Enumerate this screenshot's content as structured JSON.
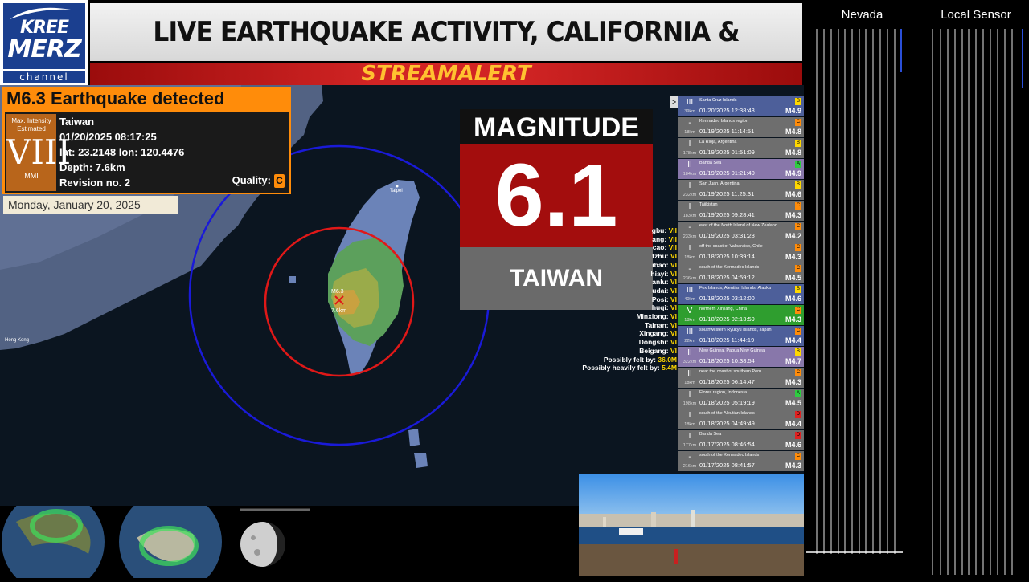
{
  "logo": {
    "line1": "KREE",
    "line2": "MERZ",
    "channel": "channel"
  },
  "header": {
    "title": "LIVE EARTHQUAKE ACTIVITY, CALIFORNIA & WORLDWIDE",
    "alert": "STREAMALERT"
  },
  "event": {
    "headline": "M6.3 Earthquake detected",
    "mmi_caption": "Max. Intensity Estimated",
    "mmi_value": "VIII",
    "mmi_label": "MMI",
    "region": "Taiwan",
    "datetime": "01/20/2025 08:17:25",
    "coords": "lat: 23.2148 lon: 120.4476",
    "depth": "Depth: 7.6km",
    "revision": "Revision no. 2",
    "quality_label": "Quality:",
    "quality_value": "C"
  },
  "date_banner": "Monday, January 20, 2025",
  "map": {
    "city_taipei": "Taipei",
    "city_hongkong": "Hong Kong",
    "marker_mag": "M6.3",
    "marker_depth": "7.6km",
    "colors": {
      "ring_inner": "#e01818",
      "ring_outer": "#1a1ad8"
    }
  },
  "magnitude_box": {
    "label": "MAGNITUDE",
    "value": "6.1",
    "region": "TAIWAN"
  },
  "cities": [
    {
      "name": "gbu:",
      "mmi": "VII"
    },
    {
      "name": "ang:",
      "mmi": "VII"
    },
    {
      "name": "cao:",
      "mmi": "VII"
    },
    {
      "name": "tzhu:",
      "mmi": "VI"
    },
    {
      "name": "ibao:",
      "mmi": "VI"
    },
    {
      "name": "hiayi:",
      "mmi": "VI"
    },
    {
      "name": "anlu:",
      "mmi": "VI"
    },
    {
      "name": "udai:",
      "mmi": "VI"
    },
    {
      "name": "Posi:",
      "mmi": "VI"
    },
    {
      "name": "huqi:",
      "mmi": "VI"
    },
    {
      "name": "Minxiong:",
      "mmi": "VI"
    },
    {
      "name": "Tainan:",
      "mmi": "VI"
    },
    {
      "name": "Xingang:",
      "mmi": "VI"
    },
    {
      "name": "Dongshi:",
      "mmi": "VI"
    },
    {
      "name": "Beigang:",
      "mmi": "VI"
    }
  ],
  "felt": {
    "possibly_label": "Possibly felt by:",
    "possibly_value": "36.0M",
    "heavily_label": "Possibly heavily felt by:",
    "heavily_value": "5.4M"
  },
  "events": [
    {
      "int": "III",
      "dist": "39km",
      "region": "Santa Cruz Islands",
      "datetime": "01/20/2025 12:38:43",
      "mag": "M4.9",
      "quality": "B",
      "bg": "#4d5f9a",
      "qc": "#ffd800"
    },
    {
      "int": "-",
      "dist": "18km",
      "region": "Kermadec Islands region",
      "datetime": "01/19/2025 11:14:51",
      "mag": "M4.8",
      "quality": "C",
      "bg": "#6e6e6e",
      "qc": "#ff8c0a"
    },
    {
      "int": "I",
      "dist": "178km",
      "region": "La Rioja, Argentina",
      "datetime": "01/19/2025 01:51:09",
      "mag": "M4.8",
      "quality": "B",
      "bg": "#6e6e6e",
      "qc": "#ffd800"
    },
    {
      "int": "II",
      "dist": "184km",
      "region": "Banda Sea",
      "datetime": "01/19/2025 01:21:40",
      "mag": "M4.9",
      "quality": "A",
      "bg": "#8877aa",
      "qc": "#2ecc40"
    },
    {
      "int": "I",
      "dist": "232km",
      "region": "San Juan, Argentina",
      "datetime": "01/19/2025 11:25:31",
      "mag": "M4.6",
      "quality": "B",
      "bg": "#6e6e6e",
      "qc": "#ffd800"
    },
    {
      "int": "I",
      "dist": "183km",
      "region": "Tajikistan",
      "datetime": "01/19/2025 09:28:41",
      "mag": "M4.3",
      "quality": "C",
      "bg": "#6e6e6e",
      "qc": "#ff8c0a"
    },
    {
      "int": "-",
      "dist": "233km",
      "region": "east of the North Island of New Zealand",
      "datetime": "01/19/2025 03:31:28",
      "mag": "M4.2",
      "quality": "C",
      "bg": "#6e6e6e",
      "qc": "#ff8c0a"
    },
    {
      "int": "I",
      "dist": "18km",
      "region": "off the coast of Valparaiso, Chile",
      "datetime": "01/18/2025 10:39:14",
      "mag": "M4.3",
      "quality": "C",
      "bg": "#6e6e6e",
      "qc": "#ff8c0a"
    },
    {
      "int": "-",
      "dist": "236km",
      "region": "south of the Kermadec Islands",
      "datetime": "01/18/2025 04:59:12",
      "mag": "M4.5",
      "quality": "C",
      "bg": "#6e6e6e",
      "qc": "#ff8c0a"
    },
    {
      "int": "III",
      "dist": "40km",
      "region": "Fox Islands, Aleutian Islands, Alaska",
      "datetime": "01/18/2025 03:12:00",
      "mag": "M4.6",
      "quality": "B",
      "bg": "#4d5f9a",
      "qc": "#ffd800"
    },
    {
      "int": "V",
      "dist": "18km",
      "region": "northern Xinjiang, China",
      "datetime": "01/18/2025 02:13:59",
      "mag": "M4.3",
      "quality": "C",
      "bg": "#2f9e2f",
      "qc": "#ff8c0a"
    },
    {
      "int": "III",
      "dist": "22km",
      "region": "southwestern Ryukyu Islands, Japan",
      "datetime": "01/18/2025 11:44:19",
      "mag": "M4.4",
      "quality": "C",
      "bg": "#4d5f9a",
      "qc": "#ff8c0a"
    },
    {
      "int": "II",
      "dist": "322km",
      "region": "New Guinea, Papua New Guinea",
      "datetime": "01/18/2025 10:38:54",
      "mag": "M4.7",
      "quality": "B",
      "bg": "#8877aa",
      "qc": "#ffd800"
    },
    {
      "int": "II",
      "dist": "18km",
      "region": "near the coast of southern Peru",
      "datetime": "01/18/2025 06:14:47",
      "mag": "M4.3",
      "quality": "C",
      "bg": "#6e6e6e",
      "qc": "#ff8c0a"
    },
    {
      "int": "I",
      "dist": "198km",
      "region": "Flores region, Indonesia",
      "datetime": "01/18/2025 05:19:19",
      "mag": "M4.5",
      "quality": "A",
      "bg": "#6e6e6e",
      "qc": "#2ecc40"
    },
    {
      "int": "I",
      "dist": "18km",
      "region": "south of the Aleutian Islands",
      "datetime": "01/18/2025 04:49:49",
      "mag": "M4.4",
      "quality": "D",
      "bg": "#6e6e6e",
      "qc": "#e02020"
    },
    {
      "int": "I",
      "dist": "177km",
      "region": "Banda Sea",
      "datetime": "01/17/2025 08:46:54",
      "mag": "M4.6",
      "quality": "D",
      "bg": "#6e6e6e",
      "qc": "#e02020"
    },
    {
      "int": "-",
      "dist": "216km",
      "region": "south of the Kermadec Islands",
      "datetime": "01/17/2025 08:41:57",
      "mag": "M4.3",
      "quality": "C",
      "bg": "#6e6e6e",
      "qc": "#ff8c0a"
    }
  ],
  "seismographs": {
    "left_label": "Nevada",
    "right_label": "Local Sensor"
  }
}
